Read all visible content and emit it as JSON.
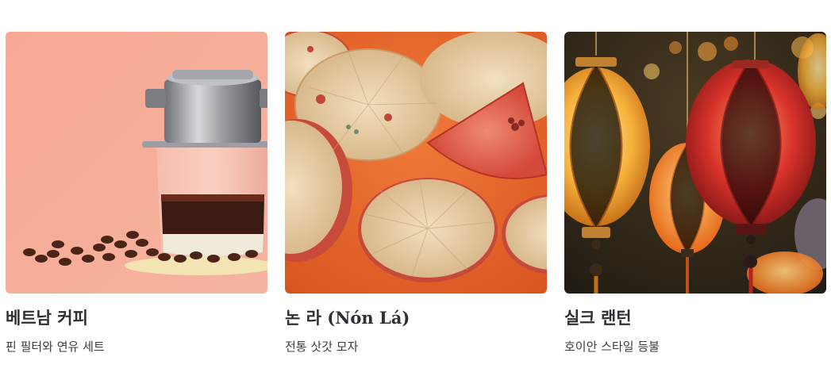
{
  "products": [
    {
      "title": "베트남 커피",
      "subtitle": "핀 필터와 연유 세트",
      "image": "vietnamese-phin-coffee-photo",
      "background_color": "#f7a890"
    },
    {
      "title": "논 라 (Nón Lá)",
      "subtitle": "전통 삿갓 모자",
      "image": "conical-hats-photo",
      "background_color": "#e8692f"
    },
    {
      "title": "실크 랜턴",
      "subtitle": "호이안 스타일 등불",
      "image": "silk-lanterns-photo",
      "background_color": "#2b2418"
    }
  ]
}
